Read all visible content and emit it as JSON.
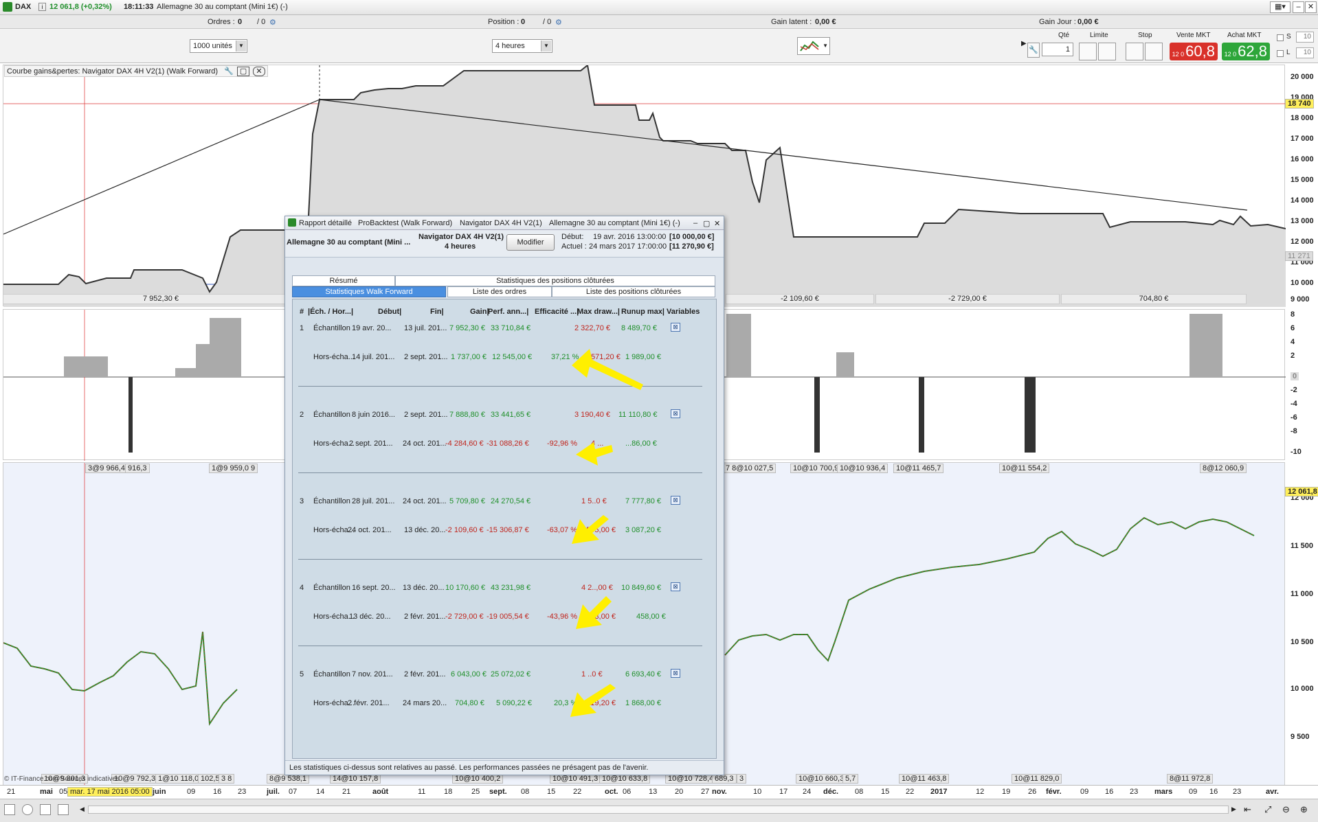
{
  "topbar": {
    "symbol": "DAX",
    "quote": "12 061,8 (+0,32%)",
    "time": "18:11:33",
    "instrument": "Allemagne 30 au comptant (Mini 1€) (-)"
  },
  "infobar": {
    "orders_label": "Ordres :",
    "orders_value": "0",
    "orders_value2": "/ 0",
    "position_label": "Position :",
    "position_value": "0",
    "position_value2": "/ 0",
    "latent_label": "Gain latent :",
    "latent_value": "0,00 €",
    "day_label": "Gain Jour :",
    "day_value": "0,00 €"
  },
  "toolbar": {
    "units": "1000 unités",
    "timeframe": "4 heures"
  },
  "trade_panel": {
    "qty_label": "Qté",
    "qty_value": "1",
    "limit_label": "Limite",
    "stop_label": "Stop",
    "sell_label": "Vente MKT",
    "sell_small": "12 0",
    "sell_price": "60,8",
    "buy_label": "Achat MKT",
    "buy_small": "12 0",
    "buy_price": "62,8",
    "s_label": "S",
    "s_value": "10",
    "l_label": "L",
    "l_value": "10",
    "sell_color": "#d9312a",
    "buy_color": "#2ea63a"
  },
  "pane1": {
    "title": "Courbe gains&pertes: Navigator DAX 4H V2(1) (Walk Forward)",
    "y_ticks": [
      "20 000",
      "19 000",
      "18 000",
      "17 000",
      "16 000",
      "15 000",
      "14 000",
      "13 000",
      "12 000",
      "11 000",
      "10 000",
      "9 000"
    ],
    "marker_top": "18 740",
    "marker_mid": "11 271",
    "segments": [
      "7 952,30 €",
      "-2 109,60 €",
      "-2 729,00 €",
      "704,80 €"
    ]
  },
  "pane2": {
    "y_ticks": [
      "8",
      "6",
      "4",
      "2",
      "0",
      "-2",
      "-4",
      "-6",
      "-8",
      "-10"
    ]
  },
  "pane3": {
    "y_ticks": [
      "12 000",
      "11 500",
      "11 000",
      "10 500",
      "10 000",
      "9 500"
    ],
    "price_marker": "12 061,8",
    "top_labels": [
      "3@9 966,4",
      "916,3",
      "1@9 959,0 9",
      "7 8@10 027,5",
      "10@10 700,9",
      "10@10 936,4",
      "10@11 465,7",
      "10@11 554,2",
      "8@12 060,9"
    ],
    "bottom_labels": [
      "10@9 801,3",
      "10@9 792,3",
      "1@10 118,0",
      "102,5",
      "3 8",
      "8@9 538,1",
      "14@10 157,8",
      "10@10 400,2",
      "10@10 491,3",
      "10@10 633,8",
      "10@10 728,4",
      "689,3",
      "3",
      "10@10 660,3",
      "5,7",
      "10@11 463,8",
      "10@11 829,0",
      "8@11 972,8"
    ],
    "copyright": "© IT-Finance.com Sources indicatives"
  },
  "xaxis": {
    "cursor_label": "mar. 17 mai 2016 05:00",
    "ticks": [
      "21",
      "mai",
      "05",
      "juin",
      "09",
      "16",
      "23",
      "juil.",
      "07",
      "14",
      "21",
      "août",
      "11",
      "18",
      "25",
      "sept.",
      "08",
      "15",
      "22",
      "oct.",
      "06",
      "13",
      "20",
      "27",
      "nov.",
      "10",
      "17",
      "24",
      "déc.",
      "08",
      "15",
      "22",
      "2017",
      "12",
      "19",
      "26",
      "févr.",
      "09",
      "16",
      "23",
      "mars",
      "09",
      "16",
      "23",
      "avr."
    ]
  },
  "dialog": {
    "tabs": [
      "Rapport détaillé",
      "ProBacktest (Walk Forward)",
      "Navigator DAX 4H V2(1)",
      "Allemagne 30 au comptant (Mini 1€) (-)"
    ],
    "instrument": "Allemagne 30 au comptant (Mini ...",
    "strategy": "Navigator DAX 4H V2(1)",
    "period": "4 heures",
    "modify_button": "Modifier",
    "start_label": "Début:",
    "start_date": "19 avr. 2016 13:00:00",
    "start_value": "[10 000,00 €]",
    "current_label": "Actuel :",
    "current_date": "24 mars 2017 17:00:00",
    "current_value": "[11 270,90 €]",
    "tab_summary": "Résumé",
    "tab_closed_stats": "Statistiques des positions clôturées",
    "tab_walk_forward": "Statistiques Walk Forward",
    "tab_orders": "Liste des ordres",
    "tab_closed_list": "Liste des positions clôturées",
    "columns": [
      "#",
      "|Éch. / Hor...|",
      "Début|",
      "Fin|",
      "Gain|",
      "Perf. ann...|",
      "Efficacité ...|",
      "Max draw...|",
      "Runup max|",
      "Variables"
    ],
    "rows": [
      {
        "num": "1",
        "sample": {
          "type": "Échantillon",
          "start": "19 avr. 20...",
          "end": "13 juil. 201...",
          "gain": "7 952,30 €",
          "perf": "33 710,84 €",
          "eff": "",
          "maxdd": "2 322,70 €",
          "runup": "8 489,70 €"
        },
        "oos": {
          "type": "Hors-écha...",
          "start": "14 juil. 201...",
          "end": "2 sept. 201...",
          "gain": "1 737,00 €",
          "perf": "12 545,00 €",
          "eff": "37,21 %",
          "maxdd": "571,20 €",
          "runup": "1 989,00 €"
        }
      },
      {
        "num": "2",
        "sample": {
          "type": "Échantillon",
          "start": "8 juin 2016...",
          "end": "2 sept. 201...",
          "gain": "7 888,80 €",
          "perf": "33 441,65 €",
          "eff": "",
          "maxdd": "3 190,40 €",
          "runup": "11 110,80 €"
        },
        "oos": {
          "type": "Hors-écha...",
          "start": "2 sept. 201...",
          "end": "24 oct. 201...",
          "gain": "-4 284,60 €",
          "perf": "-31 088,26 €",
          "eff": "-92,96 %",
          "maxdd": "4 ...",
          "runup": "...86,00 €"
        }
      },
      {
        "num": "3",
        "sample": {
          "type": "Échantillon",
          "start": "28 juil. 201...",
          "end": "24 oct. 201...",
          "gain": "5 709,80 €",
          "perf": "24 270,54 €",
          "eff": "",
          "maxdd": "1 5..0 €",
          "runup": "7 777,80 €"
        },
        "oos": {
          "type": "Hors-écha...",
          "start": "24 oct. 201...",
          "end": "13 déc. 20...",
          "gain": "-2 109,60 €",
          "perf": "-15 306,87 €",
          "eff": "-63,07 %",
          "maxdd": "4 595,00 €",
          "runup": "3 087,20 €"
        }
      },
      {
        "num": "4",
        "sample": {
          "type": "Échantillon",
          "start": "16 sept. 20...",
          "end": "13 déc. 20...",
          "gain": "10 170,60 €",
          "perf": "43 231,98 €",
          "eff": "",
          "maxdd": "4 2..,00 €",
          "runup": "10 849,60 €"
        },
        "oos": {
          "type": "Hors-écha...",
          "start": "13 déc. 20...",
          "end": "2 févr. 201...",
          "gain": "-2 729,00 €",
          "perf": "-19 005,54 €",
          "eff": "-43,96 %",
          "maxdd": "3 423,00 €",
          "runup": "458,00 €"
        }
      },
      {
        "num": "5",
        "sample": {
          "type": "Échantillon",
          "start": "7 nov. 201...",
          "end": "2 févr. 201...",
          "gain": "6 043,00 €",
          "perf": "25 072,02 €",
          "eff": "",
          "maxdd": "1 ..0 €",
          "runup": "6 693,40 €"
        },
        "oos": {
          "type": "Hors-écha...",
          "start": "2 févr. 201...",
          "end": "24 mars 20...",
          "gain": "704,80 €",
          "perf": "5 090,22 €",
          "eff": "20,3 %",
          "maxdd": "1 019,20 €",
          "runup": "1 868,00 €"
        }
      }
    ],
    "footer": "Les statistiques ci-dessus sont relatives au passé. Les performances passées ne présagent pas de l'avenir."
  },
  "colors": {
    "positive": "#1f8f2a",
    "negative": "#c0241c",
    "arrow": "#ffef00",
    "active_tab": "#4a8fe0"
  }
}
